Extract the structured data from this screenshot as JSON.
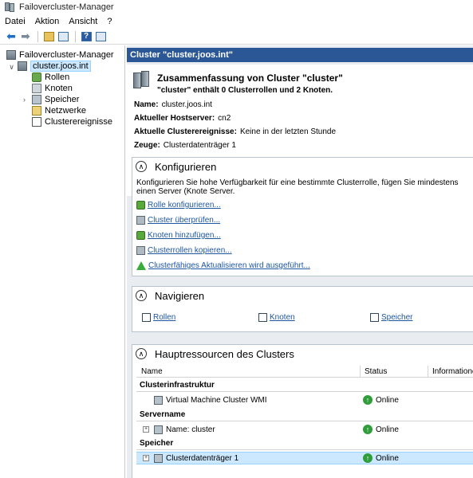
{
  "window": {
    "title": "Failovercluster-Manager"
  },
  "menu": {
    "items": [
      "Datei",
      "Aktion",
      "Ansicht",
      "?"
    ]
  },
  "tree": {
    "root": "Failovercluster-Manager",
    "cluster": "cluster.joos.int",
    "children": [
      "Rollen",
      "Knoten",
      "Speicher",
      "Netzwerke",
      "Clusterereignisse"
    ]
  },
  "main": {
    "header": "Cluster \"cluster.joos.int\"",
    "summary": {
      "title": "Zusammenfassung von Cluster \"cluster\"",
      "subtitle": "\"cluster\" enthält 0 Clusterrollen und 2 Knoten.",
      "name_label": "Name:",
      "name_value": "cluster.joos.int",
      "host_label": "Aktueller Hostserver:",
      "host_value": "cn2",
      "events_label": "Aktuelle Clusterereignisse:",
      "events_value": "Keine in der letzten Stunde",
      "witness_label": "Zeuge:",
      "witness_value": "Clusterdatenträger 1"
    },
    "configure": {
      "title": "Konfigurieren",
      "description": "Konfigurieren Sie hohe Verfügbarkeit für eine bestimmte Clusterrolle, fügen Sie mindestens einen Server (Knote Server.",
      "links": [
        "Rolle konfigurieren...",
        "Cluster überprüfen...",
        "Knoten hinzufügen...",
        "Clusterrollen kopieren...",
        "Clusterfähiges Aktualisieren wird ausgeführt..."
      ]
    },
    "navigate": {
      "title": "Navigieren",
      "links": [
        "Rollen",
        "Knoten",
        "Speicher"
      ]
    },
    "resources": {
      "title": "Hauptressourcen des Clusters",
      "columns": [
        "Name",
        "Status",
        "Informationen"
      ],
      "groups": [
        {
          "name": "Clusterinfrastruktur",
          "rows": [
            {
              "name": "Virtual Machine Cluster WMI",
              "status": "Online"
            }
          ]
        },
        {
          "name": "Servername",
          "rows": [
            {
              "name": "Name: cluster",
              "status": "Online"
            }
          ]
        },
        {
          "name": "Speicher",
          "rows": [
            {
              "name": "Clusterdatenträger 1",
              "status": "Online"
            }
          ]
        }
      ]
    }
  }
}
